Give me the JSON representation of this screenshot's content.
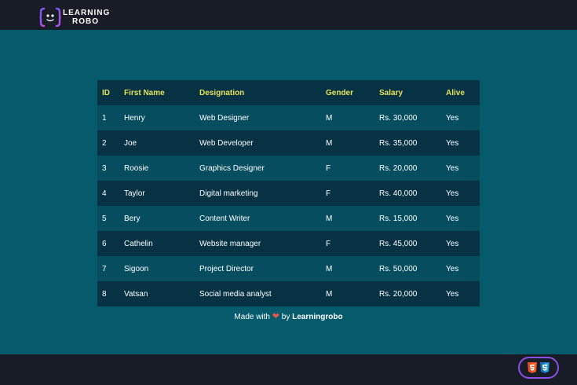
{
  "header": {
    "logo_line1": "LEARNING",
    "logo_line2": "ROBO"
  },
  "table": {
    "columns": [
      "ID",
      "First Name",
      "Designation",
      "Gender",
      "Salary",
      "Alive"
    ],
    "rows": [
      [
        "1",
        "Henry",
        "Web Designer",
        "M",
        "Rs. 30,000",
        "Yes"
      ],
      [
        "2",
        "Joe",
        "Web Developer",
        "M",
        "Rs. 35,000",
        "Yes"
      ],
      [
        "3",
        "Roosie",
        "Graphics Designer",
        "F",
        "Rs. 20,000",
        "Yes"
      ],
      [
        "4",
        "Taylor",
        "Digital marketing",
        "F",
        "Rs. 40,000",
        "Yes"
      ],
      [
        "5",
        "Bery",
        "Content Writer",
        "M",
        "Rs. 15,000",
        "Yes"
      ],
      [
        "6",
        "Cathelin",
        "Website manager",
        "F",
        "Rs. 45,000",
        "Yes"
      ],
      [
        "7",
        "Sigoon",
        "Project Director",
        "M",
        "Rs. 50,000",
        "Yes"
      ],
      [
        "8",
        "Vatsan",
        "Social media analyst",
        "M",
        "Rs. 20,000",
        "Yes"
      ]
    ]
  },
  "footer": {
    "made_with": "Made with",
    "heart": "❤",
    "by": "by",
    "brand": "Learningrobo"
  },
  "badges": [
    "html5-icon",
    "css3-icon"
  ],
  "colors": {
    "background": "#055a6c",
    "bar": "#181c26",
    "header_text": "#e6e15a",
    "row_dark": "#063243",
    "row_light": "#064e5f",
    "pill_border": "#8a4fe8"
  }
}
